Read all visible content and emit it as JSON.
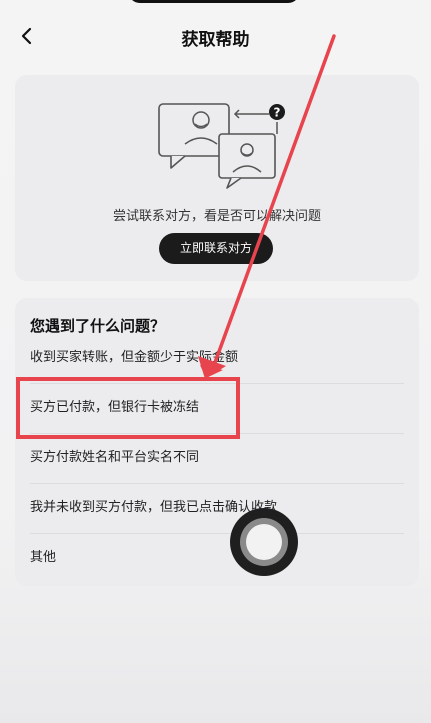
{
  "header": {
    "title": "获取帮助",
    "back_icon": "chevron-left-icon"
  },
  "contact": {
    "illustration_icon": "chat-video-help-icon",
    "question_mark": "?",
    "description": "尝试联系对方，看是否可以解决问题",
    "button_label": "立即联系对方"
  },
  "problems": {
    "title": "您遇到了什么问题？",
    "items": [
      {
        "label": "收到买家转账，但金额少于实际金额"
      },
      {
        "label": "买方已付款，但银行卡被冻结"
      },
      {
        "label": "买方付款姓名和平台实名不同"
      },
      {
        "label": "我并未收到买方付款，但我已点击确认收款"
      },
      {
        "label": "其他"
      }
    ]
  },
  "colors": {
    "annotation_red": "#e8444d",
    "button_dark": "#1b1b1b",
    "card_bg": "#ececee"
  },
  "floating_assist_icon": "assistive-touch-icon"
}
